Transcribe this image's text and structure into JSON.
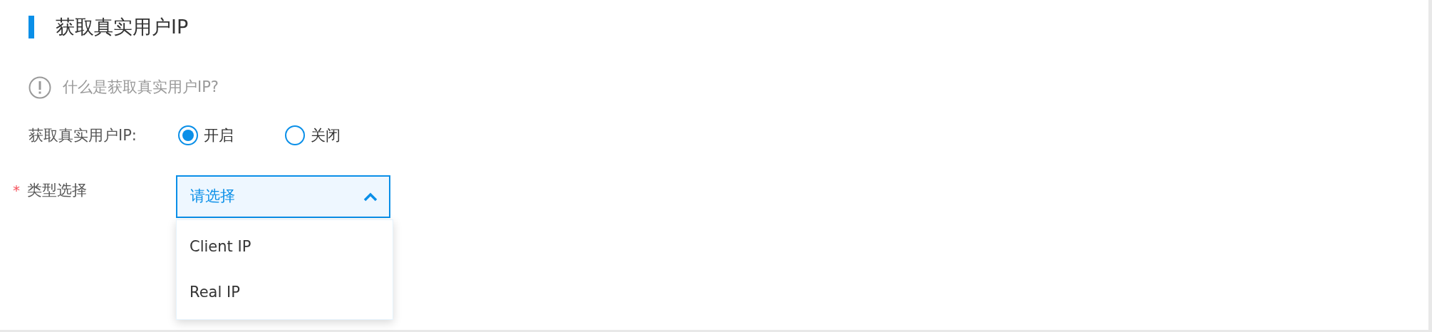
{
  "section": {
    "title": "获取真实用户IP"
  },
  "help": {
    "text": "什么是获取真实用户IP?"
  },
  "toggle": {
    "label": "获取真实用户IP:",
    "options": [
      {
        "label": "开启",
        "selected": true
      },
      {
        "label": "关闭",
        "selected": false
      }
    ]
  },
  "type_select": {
    "label": "类型选择",
    "required_mark": "*",
    "placeholder": "请选择",
    "expanded": true,
    "options": [
      {
        "label": "Client IP"
      },
      {
        "label": "Real IP"
      }
    ]
  }
}
